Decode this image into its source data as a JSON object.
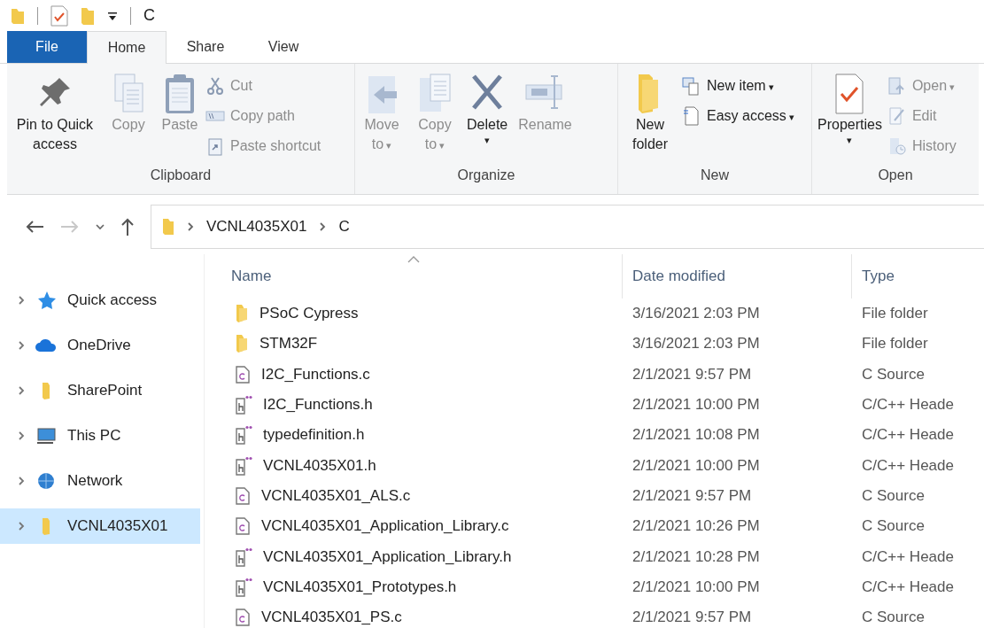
{
  "title_bar": {
    "path": "C"
  },
  "tabs": [
    {
      "label": "File",
      "kind": "file",
      "selected": false
    },
    {
      "label": "Home",
      "kind": "tab",
      "selected": true
    },
    {
      "label": "Share",
      "kind": "tab",
      "selected": false
    },
    {
      "label": "View",
      "kind": "tab",
      "selected": false
    }
  ],
  "ribbon": [
    {
      "label": "Clipboard",
      "large": [
        {
          "label": "Pin to Quick access",
          "disabled": false,
          "kind": "plain"
        },
        {
          "label": "Copy",
          "disabled": true,
          "kind": "plain"
        },
        {
          "label": "Paste",
          "disabled": true,
          "kind": "plain"
        }
      ],
      "small": [
        {
          "label": "Cut",
          "disabled": true
        },
        {
          "label": "Copy path",
          "disabled": true
        },
        {
          "label": "Paste shortcut",
          "disabled": true
        }
      ]
    },
    {
      "label": "Organize",
      "large": [
        {
          "label": "Move to",
          "disabled": true,
          "kind": "inline",
          "caret": "▾"
        },
        {
          "label": "Copy to",
          "disabled": true,
          "kind": "inline",
          "caret": "▾"
        },
        {
          "label": "Delete",
          "disabled": false,
          "kind": "below",
          "caret": "▾"
        },
        {
          "label": "Rename",
          "disabled": true,
          "kind": "plain"
        }
      ]
    },
    {
      "label": "New",
      "large": [
        {
          "label": "New folder",
          "disabled": false,
          "kind": "plain"
        }
      ],
      "small": [
        {
          "label": "New item",
          "disabled": false,
          "caret": "▾"
        },
        {
          "label": "Easy access",
          "disabled": false,
          "caret": "▾"
        }
      ]
    },
    {
      "label": "Open",
      "large": [
        {
          "label": "Properties",
          "disabled": false,
          "kind": "below",
          "caret": "▾"
        }
      ],
      "small": [
        {
          "label": "Open",
          "disabled": true,
          "caret": "▾"
        },
        {
          "label": "Edit",
          "disabled": true
        },
        {
          "label": "History",
          "disabled": true
        }
      ]
    }
  ],
  "address_bar": {
    "crumbs": [
      "VCNL4035X01",
      "C"
    ]
  },
  "sidebar": {
    "items": [
      {
        "label": "Quick access",
        "selected": false
      },
      {
        "label": "OneDrive",
        "selected": false
      },
      {
        "label": "SharePoint",
        "selected": false
      },
      {
        "label": "This PC",
        "selected": false
      },
      {
        "label": "Network",
        "selected": false
      },
      {
        "label": "VCNL4035X01",
        "selected": true
      }
    ]
  },
  "table": {
    "columns": [
      {
        "label": "Name",
        "sorted": true
      },
      {
        "label": "Date modified",
        "sorted": false
      },
      {
        "label": "Type",
        "sorted": false
      }
    ],
    "rows": [
      {
        "name": "PSoC Cypress",
        "kind": "folder",
        "date": "3/16/2021 2:03 PM",
        "type": "File folder"
      },
      {
        "name": "STM32F",
        "kind": "folder",
        "date": "3/16/2021 2:03 PM",
        "type": "File folder"
      },
      {
        "name": "I2C_Functions.c",
        "kind": "c",
        "date": "2/1/2021 9:57 PM",
        "type": "C Source"
      },
      {
        "name": "I2C_Functions.h",
        "kind": "h",
        "date": "2/1/2021 10:00 PM",
        "type": "C/C++ Heade"
      },
      {
        "name": "typedefinition.h",
        "kind": "h",
        "date": "2/1/2021 10:08 PM",
        "type": "C/C++ Heade"
      },
      {
        "name": "VCNL4035X01.h",
        "kind": "h",
        "date": "2/1/2021 10:00 PM",
        "type": "C/C++ Heade"
      },
      {
        "name": "VCNL4035X01_ALS.c",
        "kind": "c",
        "date": "2/1/2021 9:57 PM",
        "type": "C Source"
      },
      {
        "name": "VCNL4035X01_Application_Library.c",
        "kind": "c",
        "date": "2/1/2021 10:26 PM",
        "type": "C Source"
      },
      {
        "name": "VCNL4035X01_Application_Library.h",
        "kind": "h",
        "date": "2/1/2021 10:28 PM",
        "type": "C/C++ Heade"
      },
      {
        "name": "VCNL4035X01_Prototypes.h",
        "kind": "h",
        "date": "2/1/2021 10:00 PM",
        "type": "C/C++ Heade"
      },
      {
        "name": "VCNL4035X01_PS.c",
        "kind": "c",
        "date": "2/1/2021 9:57 PM",
        "type": "C Source"
      }
    ]
  }
}
